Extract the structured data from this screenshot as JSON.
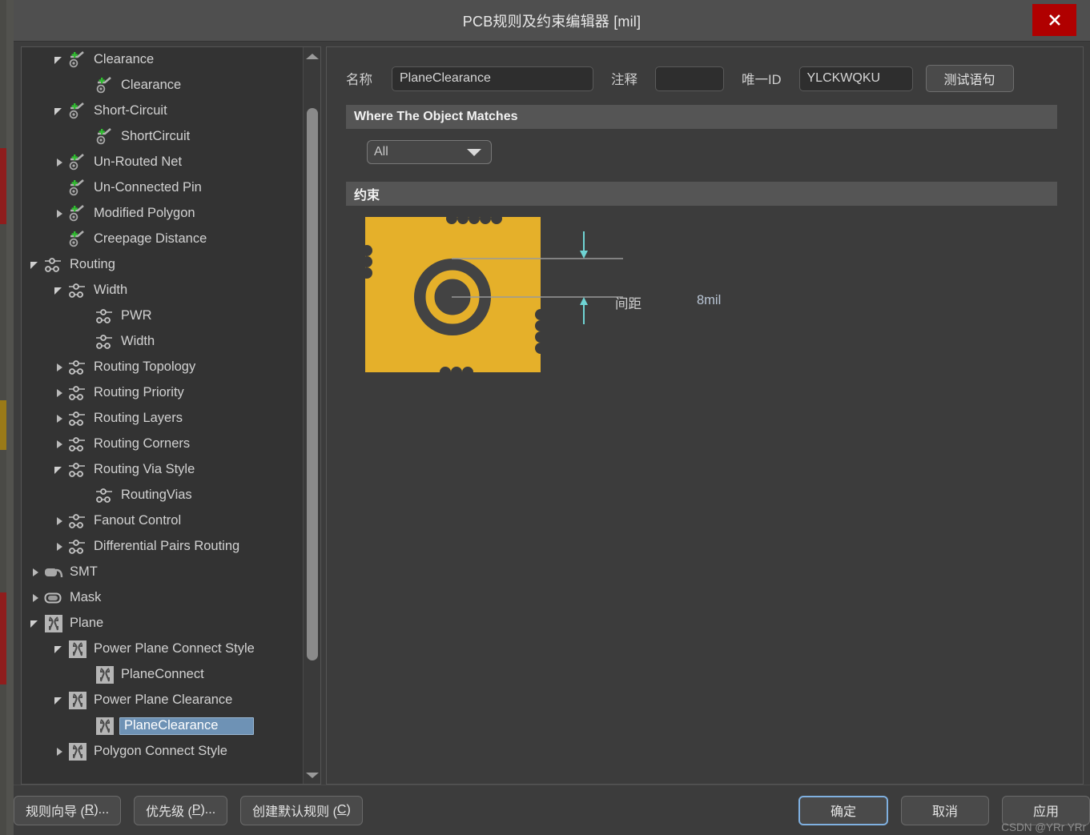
{
  "window": {
    "title": "PCB规则及约束编辑器 [mil]",
    "close_icon": "close-icon"
  },
  "tree": {
    "items": [
      {
        "label": "Clearance",
        "depth": 2,
        "arrow": "down",
        "icon": "clearance-rule-icon",
        "selected": false
      },
      {
        "label": "Clearance",
        "depth": 3,
        "arrow": "none",
        "icon": "clearance-rule-icon",
        "selected": false
      },
      {
        "label": "Short-Circuit",
        "depth": 2,
        "arrow": "down",
        "icon": "clearance-rule-icon",
        "selected": false
      },
      {
        "label": "ShortCircuit",
        "depth": 3,
        "arrow": "none",
        "icon": "clearance-rule-icon",
        "selected": false
      },
      {
        "label": "Un-Routed Net",
        "depth": 2,
        "arrow": "right",
        "icon": "clearance-rule-icon",
        "selected": false
      },
      {
        "label": "Un-Connected Pin",
        "depth": 2,
        "arrow": "none",
        "icon": "clearance-rule-icon",
        "selected": false
      },
      {
        "label": "Modified Polygon",
        "depth": 2,
        "arrow": "right",
        "icon": "clearance-rule-icon",
        "selected": false
      },
      {
        "label": "Creepage Distance",
        "depth": 2,
        "arrow": "none",
        "icon": "clearance-rule-icon",
        "selected": false
      },
      {
        "label": "Routing",
        "depth": 1,
        "arrow": "down",
        "icon": "routing-rule-icon",
        "selected": false
      },
      {
        "label": "Width",
        "depth": 2,
        "arrow": "down",
        "icon": "routing-rule-icon",
        "selected": false
      },
      {
        "label": "PWR",
        "depth": 3,
        "arrow": "none",
        "icon": "routing-rule-icon",
        "selected": false
      },
      {
        "label": "Width",
        "depth": 3,
        "arrow": "none",
        "icon": "routing-rule-icon",
        "selected": false
      },
      {
        "label": "Routing Topology",
        "depth": 2,
        "arrow": "right",
        "icon": "routing-rule-icon",
        "selected": false
      },
      {
        "label": "Routing Priority",
        "depth": 2,
        "arrow": "right",
        "icon": "routing-rule-icon",
        "selected": false
      },
      {
        "label": "Routing Layers",
        "depth": 2,
        "arrow": "right",
        "icon": "routing-rule-icon",
        "selected": false
      },
      {
        "label": "Routing Corners",
        "depth": 2,
        "arrow": "right",
        "icon": "routing-rule-icon",
        "selected": false
      },
      {
        "label": "Routing Via Style",
        "depth": 2,
        "arrow": "down",
        "icon": "routing-rule-icon",
        "selected": false
      },
      {
        "label": "RoutingVias",
        "depth": 3,
        "arrow": "none",
        "icon": "routing-rule-icon",
        "selected": false
      },
      {
        "label": "Fanout Control",
        "depth": 2,
        "arrow": "right",
        "icon": "routing-rule-icon",
        "selected": false
      },
      {
        "label": "Differential Pairs Routing",
        "depth": 2,
        "arrow": "right",
        "icon": "routing-rule-icon",
        "selected": false
      },
      {
        "label": "SMT",
        "depth": 1,
        "arrow": "right",
        "icon": "smt-rule-icon",
        "selected": false
      },
      {
        "label": "Mask",
        "depth": 1,
        "arrow": "right",
        "icon": "mask-rule-icon",
        "selected": false
      },
      {
        "label": "Plane",
        "depth": 1,
        "arrow": "down",
        "icon": "plane-rule-icon",
        "selected": false
      },
      {
        "label": "Power Plane Connect Style",
        "depth": 2,
        "arrow": "down",
        "icon": "plane-rule-icon",
        "selected": false
      },
      {
        "label": "PlaneConnect",
        "depth": 3,
        "arrow": "none",
        "icon": "plane-rule-icon",
        "selected": false
      },
      {
        "label": "Power Plane Clearance",
        "depth": 2,
        "arrow": "down",
        "icon": "plane-rule-icon",
        "selected": false
      },
      {
        "label": "PlaneClearance",
        "depth": 3,
        "arrow": "none",
        "icon": "plane-rule-icon",
        "selected": true
      },
      {
        "label": "Polygon Connect Style",
        "depth": 2,
        "arrow": "right",
        "icon": "plane-rule-icon",
        "selected": false
      }
    ],
    "scrollbar": {
      "up_icon": "scroll-up-arrow-icon",
      "down_icon": "scroll-down-arrow-icon"
    }
  },
  "form": {
    "name_label": "名称",
    "name_value": "PlaneClearance",
    "comment_label": "注释",
    "comment_value": "",
    "comment_placeholder": "",
    "uid_label": "唯一ID",
    "uid_value": "YLCKWQKU",
    "test_button": "测试语句"
  },
  "where_section": {
    "header": "Where The Object Matches",
    "scope_value": "All",
    "scope_arrow_icon": "chevron-down-icon"
  },
  "constraint_section": {
    "header": "约束",
    "dimension_label": "间距",
    "dimension_value": "8mil",
    "diagram_icon": "plane-clearance-diagram",
    "colors": {
      "plane": "#e5b02a",
      "board": "#434343",
      "dimension_arrow": "#6fd4d4"
    }
  },
  "footer": {
    "rule_wizard": {
      "text": "规则向导 (R)...",
      "pre": "规则向导 (",
      "acc": "R",
      "post": ")..."
    },
    "priority": {
      "text": "优先级 (P)...",
      "pre": "优先级 (",
      "acc": "P",
      "post": ")..."
    },
    "create_default": {
      "text": "创建默认规则 (C)",
      "pre": "创建默认规则 (",
      "acc": "C",
      "post": ")"
    },
    "ok": "确定",
    "cancel": "取消",
    "apply": "应用"
  },
  "watermark": "CSDN @YRr YRr"
}
